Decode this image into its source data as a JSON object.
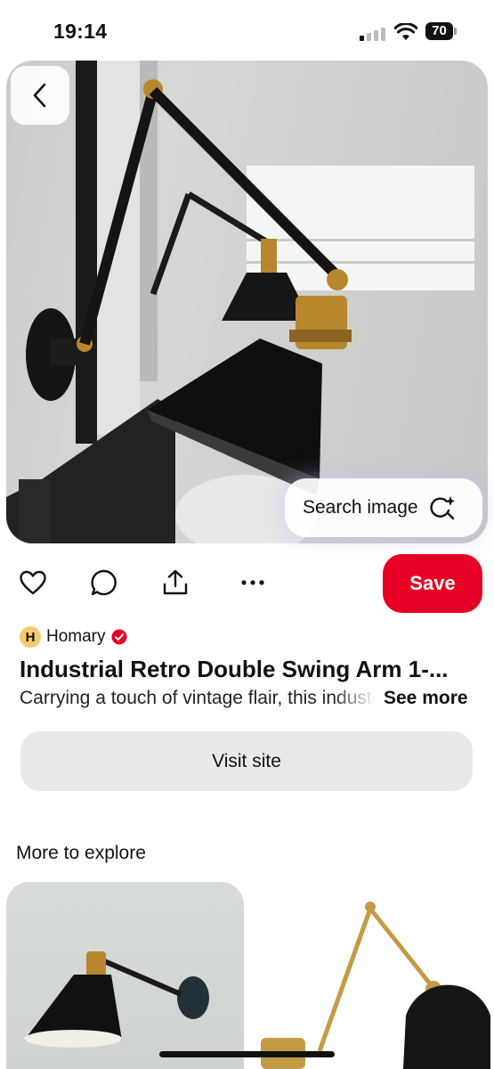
{
  "status_bar": {
    "time": "19:14",
    "battery": "70"
  },
  "hero": {
    "search_image_label": "Search image"
  },
  "actions": {
    "save_label": "Save",
    "more_label": "..."
  },
  "pin": {
    "creator_initial": "H",
    "creator_name": "Homary",
    "title": "Industrial Retro Double Swing Arm 1-...",
    "description": "Carrying a touch of vintage flair, this industrial",
    "see_more_label": "See more",
    "visit_site_label": "Visit site"
  },
  "explore": {
    "heading": "More to explore"
  },
  "colors": {
    "save_red": "#e60023",
    "visit_gray": "#e9e9e7",
    "verified_red": "#e60023"
  }
}
